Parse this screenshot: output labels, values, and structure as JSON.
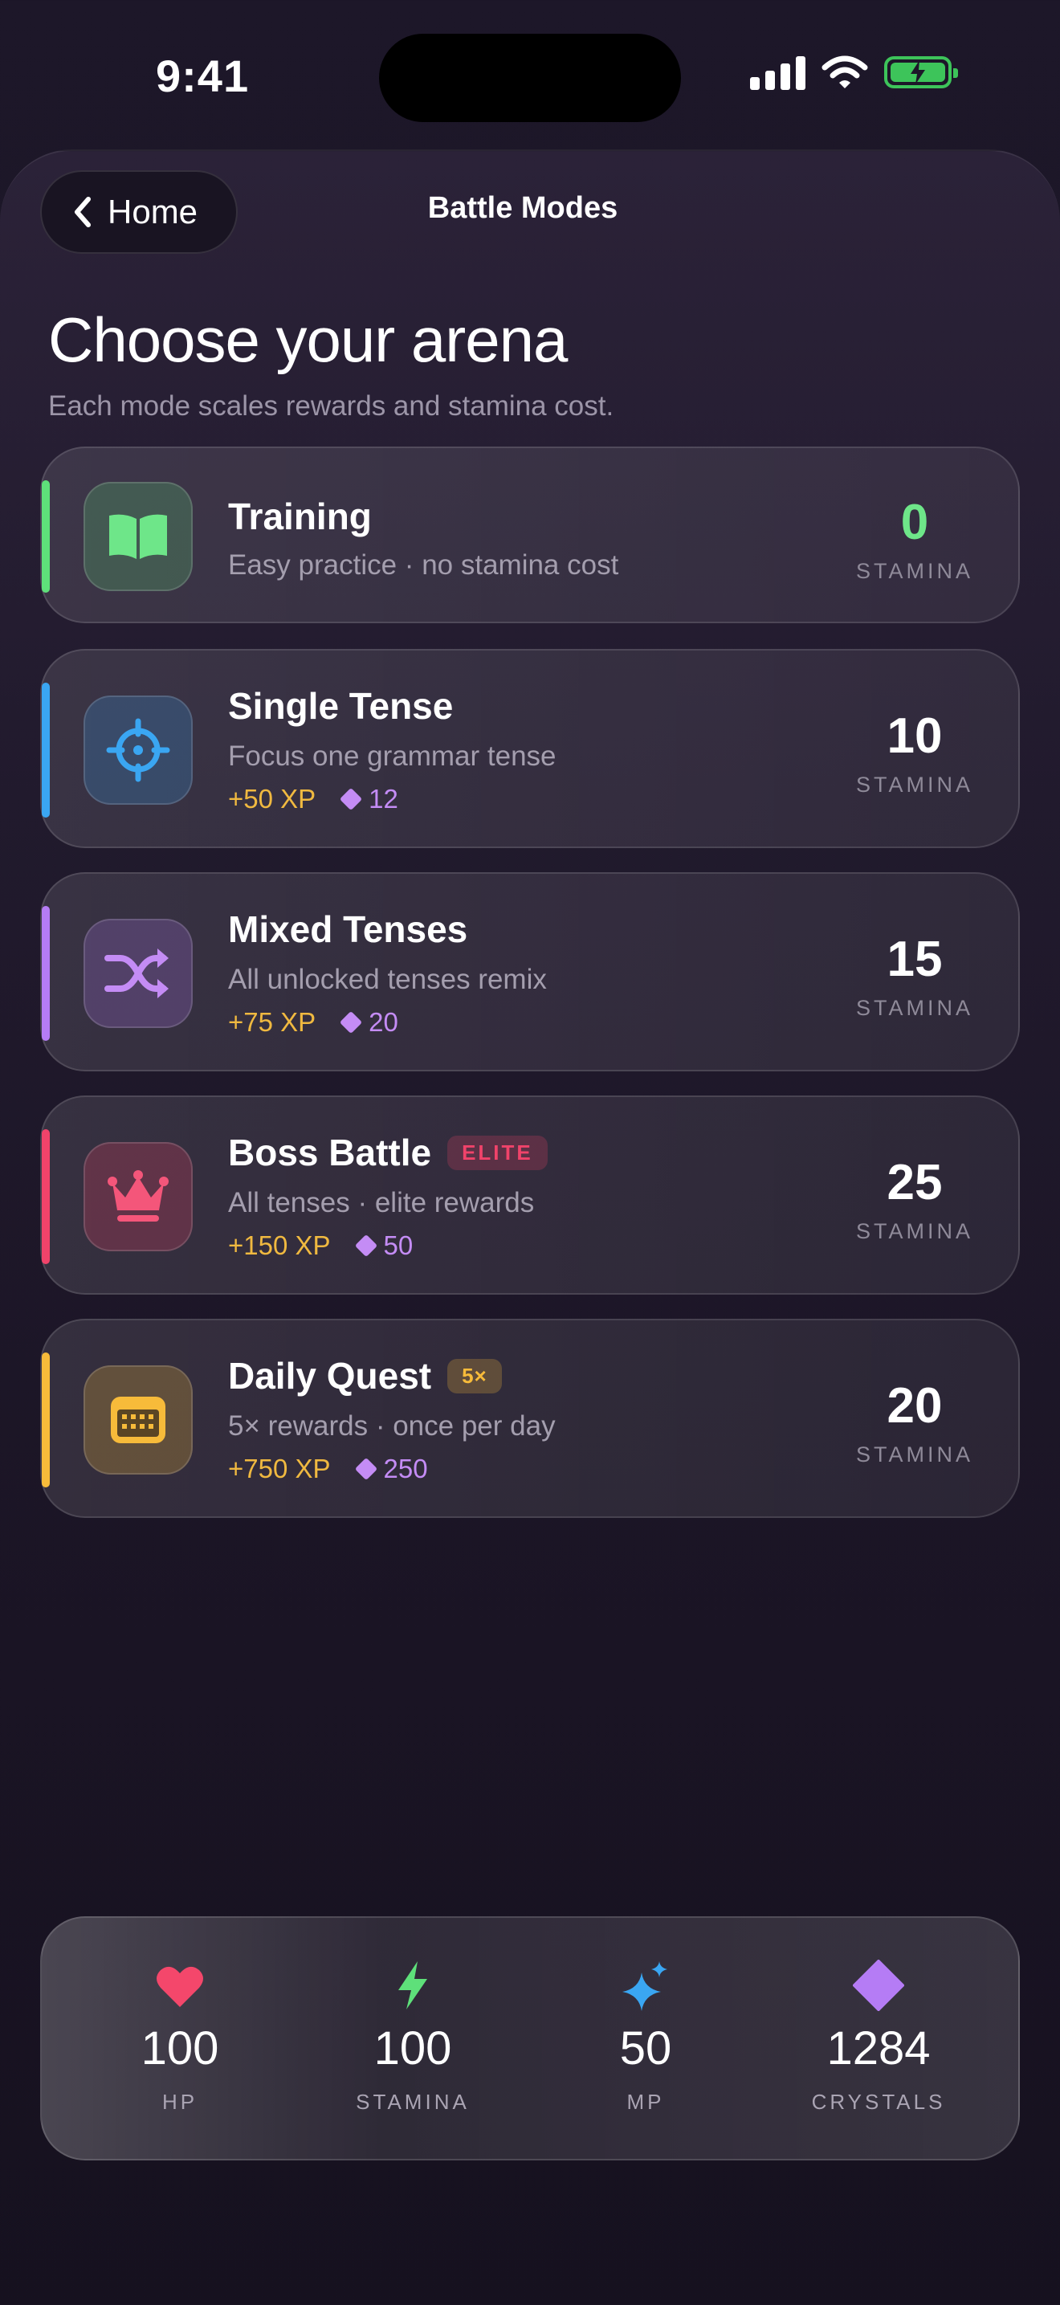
{
  "status_bar": {
    "time": "9:41"
  },
  "nav": {
    "back_label": "Home",
    "title": "Battle Modes"
  },
  "header": {
    "title": "Choose your arena",
    "subtitle": "Each mode scales rewards and stamina cost."
  },
  "modes": [
    {
      "name": "Training",
      "description": "Easy practice · no stamina cost",
      "xp": "",
      "crystals": "",
      "tag": "",
      "stamina": "0",
      "stamina_label": "STAMINA",
      "icon": "book-icon",
      "accent": "#5ee07a"
    },
    {
      "name": "Single Tense",
      "description": "Focus one grammar tense",
      "xp": "+50 XP",
      "crystals": "12",
      "tag": "",
      "stamina": "10",
      "stamina_label": "STAMINA",
      "icon": "crosshair-icon",
      "accent": "#3aa6f2"
    },
    {
      "name": "Mixed Tenses",
      "description": "All unlocked tenses remix",
      "xp": "+75 XP",
      "crystals": "20",
      "tag": "",
      "stamina": "15",
      "stamina_label": "STAMINA",
      "icon": "shuffle-icon",
      "accent": "#b57cf5"
    },
    {
      "name": "Boss Battle",
      "description": "All tenses · elite rewards",
      "xp": "+150 XP",
      "crystals": "50",
      "tag": "ELITE",
      "stamina": "25",
      "stamina_label": "STAMINA",
      "icon": "crown-icon",
      "accent": "#f0436a"
    },
    {
      "name": "Daily Quest",
      "description": "5× rewards · once per day",
      "xp": "+750 XP",
      "crystals": "250",
      "tag": "5×",
      "stamina": "20",
      "stamina_label": "STAMINA",
      "icon": "calendar-icon",
      "accent": "#f7bb3a"
    }
  ],
  "resources": [
    {
      "value": "100",
      "label": "HP",
      "icon": "heart-icon",
      "color": "#f4476b"
    },
    {
      "value": "100",
      "label": "STAMINA",
      "icon": "bolt-icon",
      "color": "#5ee07a"
    },
    {
      "value": "50",
      "label": "MP",
      "icon": "sparkles-icon",
      "color": "#3aa6f2"
    },
    {
      "value": "1284",
      "label": "CRYSTALS",
      "icon": "diamond-icon",
      "color": "#b57cf5"
    }
  ]
}
